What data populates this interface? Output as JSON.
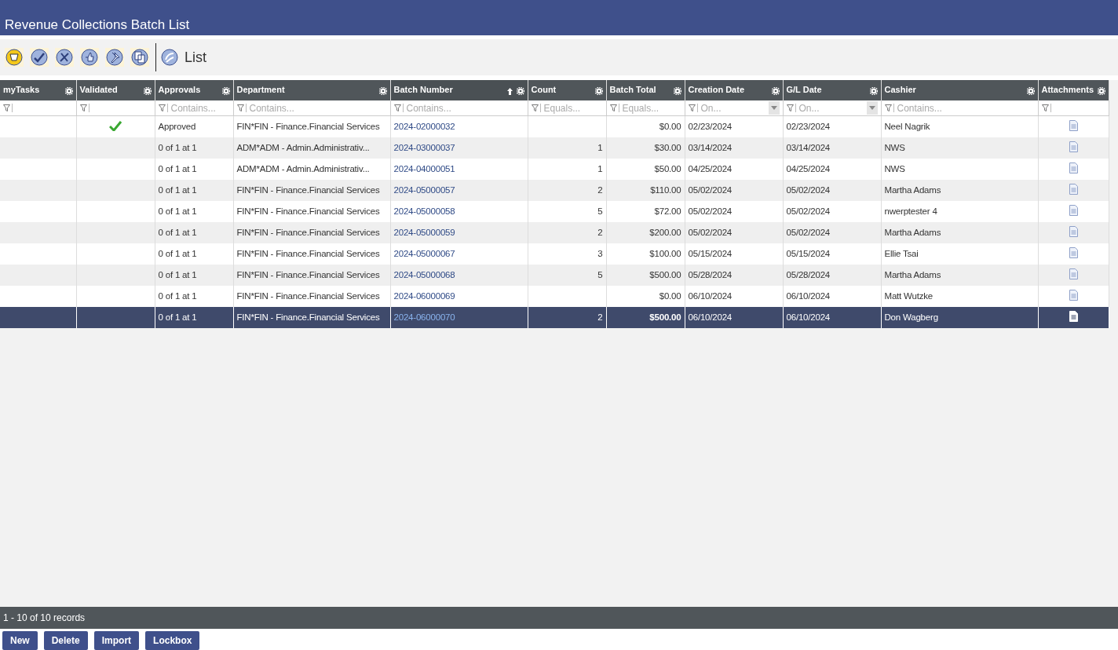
{
  "window": {
    "title": "Revenue Collections Batch List"
  },
  "toolbar": {
    "view_label": "List"
  },
  "table": {
    "columns": [
      {
        "label": "myTasks",
        "kind": "plain",
        "sorted": false
      },
      {
        "label": "Validated",
        "kind": "plain",
        "sorted": false
      },
      {
        "label": "Approvals",
        "kind": "text",
        "filter_placeholder": "Contains...",
        "sorted": false
      },
      {
        "label": "Department",
        "kind": "text",
        "filter_placeholder": "Contains...",
        "sorted": false
      },
      {
        "label": "Batch Number",
        "kind": "text",
        "filter_placeholder": "Contains...",
        "sorted": true
      },
      {
        "label": "Count",
        "kind": "number",
        "filter_placeholder": "Equals...",
        "sorted": false
      },
      {
        "label": "Batch Total",
        "kind": "number",
        "filter_placeholder": "Equals...",
        "sorted": false
      },
      {
        "label": "Creation Date",
        "kind": "date",
        "filter_placeholder": "On...",
        "sorted": false
      },
      {
        "label": "G/L Date",
        "kind": "date",
        "filter_placeholder": "On...",
        "sorted": false
      },
      {
        "label": "Cashier",
        "kind": "text",
        "filter_placeholder": "Contains...",
        "sorted": false
      },
      {
        "label": "Attachments",
        "kind": "plain",
        "sorted": false
      }
    ],
    "rows": [
      {
        "validated": true,
        "selected": false,
        "approvals": "Approved",
        "department": "FIN*FIN - Finance.Financial Services",
        "batch_number": "2024-02000032",
        "count": "",
        "batch_total": "$0.00",
        "creation_date": "02/23/2024",
        "gl_date": "02/23/2024",
        "cashier": "Neel Nagrik"
      },
      {
        "validated": false,
        "selected": false,
        "approvals": "0 of 1 at 1",
        "department": "ADM*ADM - Admin.Administrativ...",
        "batch_number": "2024-03000037",
        "count": "1",
        "batch_total": "$30.00",
        "creation_date": "03/14/2024",
        "gl_date": "03/14/2024",
        "cashier": "NWS"
      },
      {
        "validated": false,
        "selected": false,
        "approvals": "0 of 1 at 1",
        "department": "ADM*ADM - Admin.Administrativ...",
        "batch_number": "2024-04000051",
        "count": "1",
        "batch_total": "$50.00",
        "creation_date": "04/25/2024",
        "gl_date": "04/25/2024",
        "cashier": "NWS"
      },
      {
        "validated": false,
        "selected": false,
        "approvals": "0 of 1 at 1",
        "department": "FIN*FIN - Finance.Financial Services",
        "batch_number": "2024-05000057",
        "count": "2",
        "batch_total": "$110.00",
        "creation_date": "05/02/2024",
        "gl_date": "05/02/2024",
        "cashier": "Martha Adams"
      },
      {
        "validated": false,
        "selected": false,
        "approvals": "0 of 1 at 1",
        "department": "FIN*FIN - Finance.Financial Services",
        "batch_number": "2024-05000058",
        "count": "5",
        "batch_total": "$72.00",
        "creation_date": "05/02/2024",
        "gl_date": "05/02/2024",
        "cashier": "nwerptester 4"
      },
      {
        "validated": false,
        "selected": false,
        "approvals": "0 of 1 at 1",
        "department": "FIN*FIN - Finance.Financial Services",
        "batch_number": "2024-05000059",
        "count": "2",
        "batch_total": "$200.00",
        "creation_date": "05/02/2024",
        "gl_date": "05/02/2024",
        "cashier": "Martha Adams"
      },
      {
        "validated": false,
        "selected": false,
        "approvals": "0 of 1 at 1",
        "department": "FIN*FIN - Finance.Financial Services",
        "batch_number": "2024-05000067",
        "count": "3",
        "batch_total": "$100.00",
        "creation_date": "05/15/2024",
        "gl_date": "05/15/2024",
        "cashier": "Ellie Tsai"
      },
      {
        "validated": false,
        "selected": false,
        "approvals": "0 of 1 at 1",
        "department": "FIN*FIN - Finance.Financial Services",
        "batch_number": "2024-05000068",
        "count": "5",
        "batch_total": "$500.00",
        "creation_date": "05/28/2024",
        "gl_date": "05/28/2024",
        "cashier": "Martha Adams"
      },
      {
        "validated": false,
        "selected": false,
        "approvals": "0 of 1 at 1",
        "department": "FIN*FIN - Finance.Financial Services",
        "batch_number": "2024-06000069",
        "count": "",
        "batch_total": "$0.00",
        "creation_date": "06/10/2024",
        "gl_date": "06/10/2024",
        "cashier": "Matt Wutzke"
      },
      {
        "validated": false,
        "selected": true,
        "approvals": "0 of 1 at 1",
        "department": "FIN*FIN - Finance.Financial Services",
        "batch_number": "2024-06000070",
        "count": "2",
        "batch_total": "$500.00",
        "creation_date": "06/10/2024",
        "gl_date": "06/10/2024",
        "cashier": "Don Wagberg"
      }
    ]
  },
  "status_bar": {
    "records": "1 - 10 of 10 records"
  },
  "buttons": [
    "New",
    "Delete",
    "Import",
    "Lockbox"
  ]
}
